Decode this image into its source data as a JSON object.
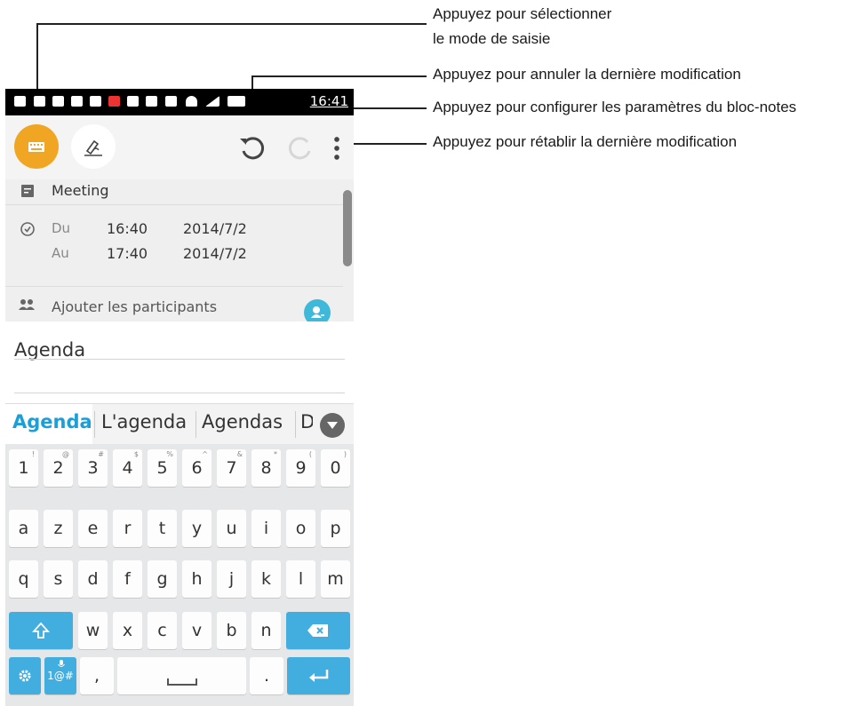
{
  "annotations": {
    "mode_line1": "Appuyez pour sélectionner",
    "mode_line2": "le mode de saisie",
    "undo": "Appuyez pour annuler la dernière modification",
    "settings": "Appuyez pour configurer les paramètres du bloc-notes",
    "redo": "Appuyez pour rétablir la dernière modification"
  },
  "status_bar": {
    "time": "16:41"
  },
  "event": {
    "title": "Meeting",
    "from_label": "Du",
    "from_time": "16:40",
    "from_date": "2014/7/2",
    "to_label": "Au",
    "to_time": "17:40",
    "to_date": "2014/7/2",
    "participants_label": "Ajouter les participants"
  },
  "notes": {
    "text": "Agenda"
  },
  "suggestions": [
    "Agenda",
    "L'agenda",
    "Agendas",
    "D"
  ],
  "keyboard": {
    "number_row": [
      {
        "key": "1",
        "sup": "!"
      },
      {
        "key": "2",
        "sup": "@"
      },
      {
        "key": "3",
        "sup": "#"
      },
      {
        "key": "4",
        "sup": "$"
      },
      {
        "key": "5",
        "sup": "%"
      },
      {
        "key": "6",
        "sup": "^"
      },
      {
        "key": "7",
        "sup": "&"
      },
      {
        "key": "8",
        "sup": "*"
      },
      {
        "key": "9",
        "sup": "("
      },
      {
        "key": "0",
        "sup": ")"
      }
    ],
    "row1": [
      "a",
      "z",
      "e",
      "r",
      "t",
      "y",
      "u",
      "i",
      "o",
      "p"
    ],
    "row2": [
      "q",
      "s",
      "d",
      "f",
      "g",
      "h",
      "j",
      "k",
      "l",
      "m"
    ],
    "row3": [
      "w",
      "x",
      "c",
      "v",
      "b",
      "n"
    ],
    "symbols_label": "1@#",
    "comma": ",",
    "period": "."
  },
  "colors": {
    "accent_orange": "#f0a623",
    "keyboard_blue": "#42aee0",
    "avatar_teal": "#3fb9d9"
  }
}
